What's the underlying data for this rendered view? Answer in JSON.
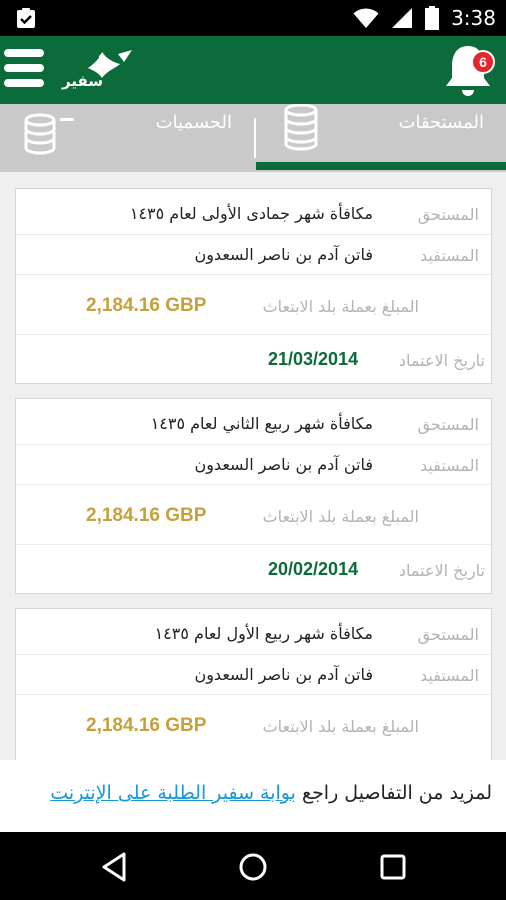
{
  "status_bar": {
    "time": "3:38",
    "icons": [
      "clipboard-check-icon",
      "wifi-icon",
      "signal-icon",
      "battery-icon"
    ]
  },
  "header": {
    "logo_text": "سفير",
    "notification_count": "6",
    "icons": [
      "hamburger-menu-icon",
      "bell-icon"
    ]
  },
  "tabs": [
    {
      "label": "المستحقات",
      "active": true,
      "icon": "coins-stack-icon"
    },
    {
      "label": "الحسميات",
      "active": false,
      "icon": "coins-minus-icon"
    }
  ],
  "cards": [
    {
      "due_label": "المستحق",
      "due_value": "مكافأة شهر جمادى الأولى لعام ١٤٣٥",
      "beneficiary_label": "المستفيد",
      "beneficiary_value": "فاتن آدم بن ناصر السعدون",
      "amount_label": "المبلغ بعملة بلد الابتعاث",
      "amount_value": "2,184.16 GBP",
      "date_label": "تاريخ الاعتماد",
      "date_value": "21/03/2014"
    },
    {
      "due_label": "المستحق",
      "due_value": "مكافأة شهر ربيع الثاني لعام ١٤٣٥",
      "beneficiary_label": "المستفيد",
      "beneficiary_value": "فاتن آدم بن ناصر السعدون",
      "amount_label": "المبلغ بعملة بلد الابتعاث",
      "amount_value": "2,184.16 GBP",
      "date_label": "تاريخ الاعتماد",
      "date_value": "20/02/2014"
    },
    {
      "due_label": "المستحق",
      "due_value": "مكافأة شهر ربيع الأول لعام ١٤٣٥",
      "beneficiary_label": "المستفيد",
      "beneficiary_value": "فاتن آدم بن ناصر السعدون",
      "amount_label": "المبلغ بعملة بلد الابتعاث",
      "amount_value": "2,184.16 GBP"
    }
  ],
  "footer": {
    "text": "لمزيد من التفاصيل راجع",
    "link": "بوابة سفير الطلبة على الإنترنت"
  },
  "nav_bar": {
    "icons": [
      "back-triangle-icon",
      "home-circle-icon",
      "recents-square-icon"
    ]
  },
  "colors": {
    "brand_green": "#0b6b3a",
    "amount_gold": "#c6a13a",
    "link_blue": "#1597d8",
    "badge_red": "#e5252a"
  }
}
